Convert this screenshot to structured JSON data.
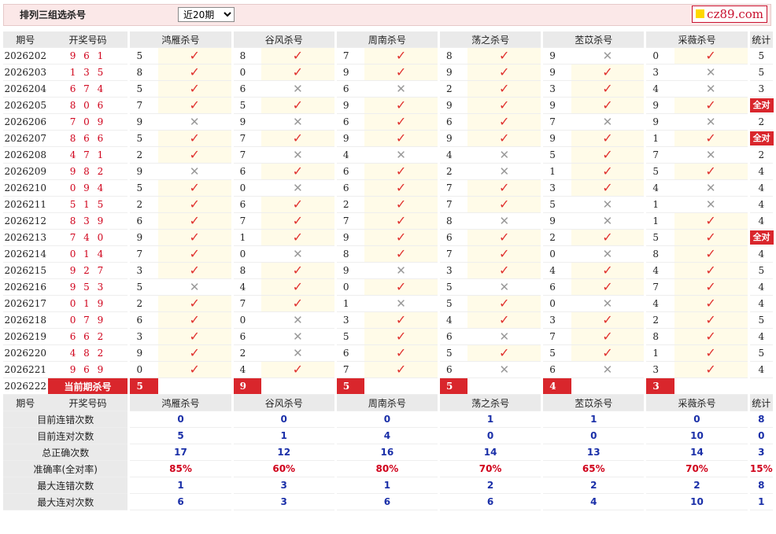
{
  "header": {
    "title": "排列三组选杀号",
    "select_value": "近20期",
    "logo_text": "cz89.com"
  },
  "columns": {
    "issue": "期号",
    "number": "开奖号码",
    "experts": [
      "鸿雁杀号",
      "谷风杀号",
      "周南杀号",
      "荡之杀号",
      "苤苡杀号",
      "采薇杀号"
    ],
    "stat": "统计"
  },
  "rows": [
    {
      "issue": "2026202",
      "num": "9 6 1",
      "kills": [
        5,
        8,
        7,
        8,
        9,
        0
      ],
      "res": [
        1,
        1,
        1,
        1,
        0,
        1
      ],
      "stat": "5"
    },
    {
      "issue": "2026203",
      "num": "1 3 5",
      "kills": [
        8,
        0,
        9,
        9,
        9,
        3
      ],
      "res": [
        1,
        1,
        1,
        1,
        1,
        0
      ],
      "stat": "5"
    },
    {
      "issue": "2026204",
      "num": "6 7 4",
      "kills": [
        5,
        6,
        6,
        2,
        3,
        4
      ],
      "res": [
        1,
        0,
        0,
        1,
        1,
        0
      ],
      "stat": "3"
    },
    {
      "issue": "2026205",
      "num": "8 0 6",
      "kills": [
        7,
        5,
        9,
        9,
        9,
        9
      ],
      "res": [
        1,
        1,
        1,
        1,
        1,
        1
      ],
      "stat": "全对"
    },
    {
      "issue": "2026206",
      "num": "7 0 9",
      "kills": [
        9,
        9,
        6,
        6,
        7,
        9
      ],
      "res": [
        0,
        0,
        1,
        1,
        0,
        0
      ],
      "stat": "2"
    },
    {
      "issue": "2026207",
      "num": "8 6 6",
      "kills": [
        5,
        7,
        9,
        9,
        9,
        1
      ],
      "res": [
        1,
        1,
        1,
        1,
        1,
        1
      ],
      "stat": "全对"
    },
    {
      "issue": "2026208",
      "num": "4 7 1",
      "kills": [
        2,
        7,
        4,
        4,
        5,
        7
      ],
      "res": [
        1,
        0,
        0,
        0,
        1,
        0
      ],
      "stat": "2"
    },
    {
      "issue": "2026209",
      "num": "9 8 2",
      "kills": [
        9,
        6,
        6,
        2,
        1,
        5
      ],
      "res": [
        0,
        1,
        1,
        0,
        1,
        1
      ],
      "stat": "4"
    },
    {
      "issue": "2026210",
      "num": "0 9 4",
      "kills": [
        5,
        0,
        6,
        7,
        3,
        4
      ],
      "res": [
        1,
        0,
        1,
        1,
        1,
        0
      ],
      "stat": "4"
    },
    {
      "issue": "2026211",
      "num": "5 1 5",
      "kills": [
        2,
        6,
        2,
        7,
        5,
        1
      ],
      "res": [
        1,
        1,
        1,
        1,
        0,
        0
      ],
      "stat": "4"
    },
    {
      "issue": "2026212",
      "num": "8 3 9",
      "kills": [
        6,
        7,
        7,
        8,
        9,
        1
      ],
      "res": [
        1,
        1,
        1,
        0,
        0,
        1
      ],
      "stat": "4"
    },
    {
      "issue": "2026213",
      "num": "7 4 0",
      "kills": [
        9,
        1,
        9,
        6,
        2,
        5
      ],
      "res": [
        1,
        1,
        1,
        1,
        1,
        1
      ],
      "stat": "全对"
    },
    {
      "issue": "2026214",
      "num": "0 1 4",
      "kills": [
        7,
        0,
        8,
        7,
        0,
        8
      ],
      "res": [
        1,
        0,
        1,
        1,
        0,
        1
      ],
      "stat": "4"
    },
    {
      "issue": "2026215",
      "num": "9 2 7",
      "kills": [
        3,
        8,
        9,
        3,
        4,
        4
      ],
      "res": [
        1,
        1,
        0,
        1,
        1,
        1
      ],
      "stat": "5"
    },
    {
      "issue": "2026216",
      "num": "9 5 3",
      "kills": [
        5,
        4,
        0,
        5,
        6,
        7
      ],
      "res": [
        0,
        1,
        1,
        0,
        1,
        1
      ],
      "stat": "4"
    },
    {
      "issue": "2026217",
      "num": "0 1 9",
      "kills": [
        2,
        7,
        1,
        5,
        0,
        4
      ],
      "res": [
        1,
        1,
        0,
        1,
        0,
        1
      ],
      "stat": "4"
    },
    {
      "issue": "2026218",
      "num": "0 7 9",
      "kills": [
        6,
        0,
        3,
        4,
        3,
        2
      ],
      "res": [
        1,
        0,
        1,
        1,
        1,
        1
      ],
      "stat": "5"
    },
    {
      "issue": "2026219",
      "num": "6 6 2",
      "kills": [
        3,
        6,
        5,
        6,
        7,
        8
      ],
      "res": [
        1,
        0,
        1,
        0,
        1,
        1
      ],
      "stat": "4"
    },
    {
      "issue": "2026220",
      "num": "4 8 2",
      "kills": [
        9,
        2,
        6,
        5,
        5,
        1
      ],
      "res": [
        1,
        0,
        1,
        1,
        1,
        1
      ],
      "stat": "5"
    },
    {
      "issue": "2026221",
      "num": "9 6 9",
      "kills": [
        0,
        4,
        7,
        6,
        6,
        3
      ],
      "res": [
        1,
        1,
        1,
        0,
        0,
        1
      ],
      "stat": "4"
    }
  ],
  "current": {
    "issue": "2026222",
    "label": "当前期杀号",
    "kills": [
      5,
      9,
      5,
      5,
      4,
      3
    ]
  },
  "summary": {
    "labels": [
      "目前连错次数",
      "目前连对次数",
      "总正确次数",
      "准确率(全对率)",
      "最大连错次数",
      "最大连对次数"
    ],
    "values": [
      [
        "0",
        "0",
        "0",
        "1",
        "1",
        "0",
        "8"
      ],
      [
        "5",
        "1",
        "4",
        "0",
        "0",
        "10",
        "0"
      ],
      [
        "17",
        "12",
        "16",
        "14",
        "13",
        "14",
        "3"
      ],
      [
        "85%",
        "60%",
        "80%",
        "70%",
        "65%",
        "70%",
        "15%"
      ],
      [
        "1",
        "3",
        "1",
        "2",
        "2",
        "2",
        "8"
      ],
      [
        "6",
        "3",
        "6",
        "6",
        "4",
        "10",
        "1"
      ]
    ]
  },
  "icons": {
    "right": "check-icon",
    "wrong": "cross-icon"
  },
  "colors": {
    "right": "#e0312e",
    "wrong": "#999999",
    "current_bg": "#d9262c",
    "summary_blue": "#1a2fa8"
  }
}
